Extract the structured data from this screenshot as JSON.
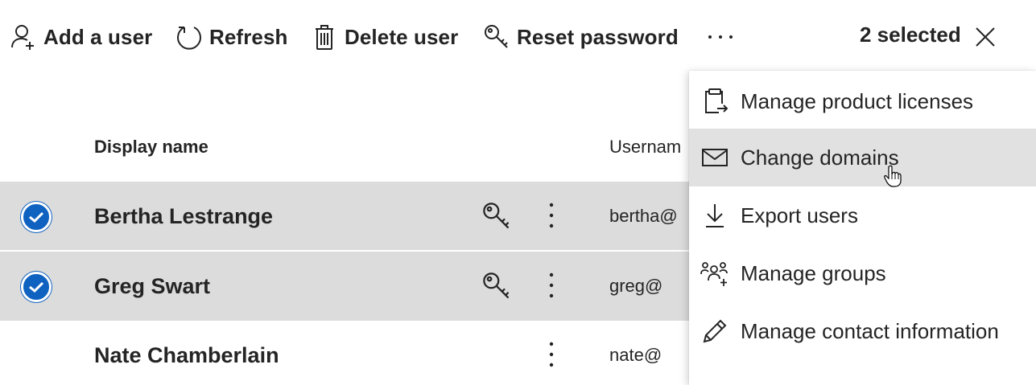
{
  "toolbar": {
    "add_user": "Add a user",
    "refresh": "Refresh",
    "delete_user": "Delete user",
    "reset_password": "Reset password",
    "more": "···",
    "selected_count": "2 selected"
  },
  "table": {
    "headers": {
      "display_name": "Display name",
      "username": "Usernam"
    },
    "rows": [
      {
        "name": "Bertha Lestrange",
        "username": "bertha@",
        "selected": true
      },
      {
        "name": "Greg Swart",
        "username": "greg@",
        "selected": true
      },
      {
        "name": "Nate Chamberlain",
        "username": "nate@",
        "selected": false
      }
    ]
  },
  "menu": {
    "items": [
      {
        "label": "Manage product licenses",
        "icon": "clipboard-arrow-icon"
      },
      {
        "label": "Change domains",
        "icon": "mail-icon",
        "hovered": true
      },
      {
        "label": "Export users",
        "icon": "download-icon"
      },
      {
        "label": "Manage groups",
        "icon": "people-add-icon"
      },
      {
        "label": "Manage contact information",
        "icon": "pencil-icon"
      }
    ]
  },
  "colors": {
    "selected_row": "#dcdcdc",
    "checkbox_blue": "#0f62c0",
    "menu_hover": "#e1e1e1",
    "text": "#242424"
  }
}
